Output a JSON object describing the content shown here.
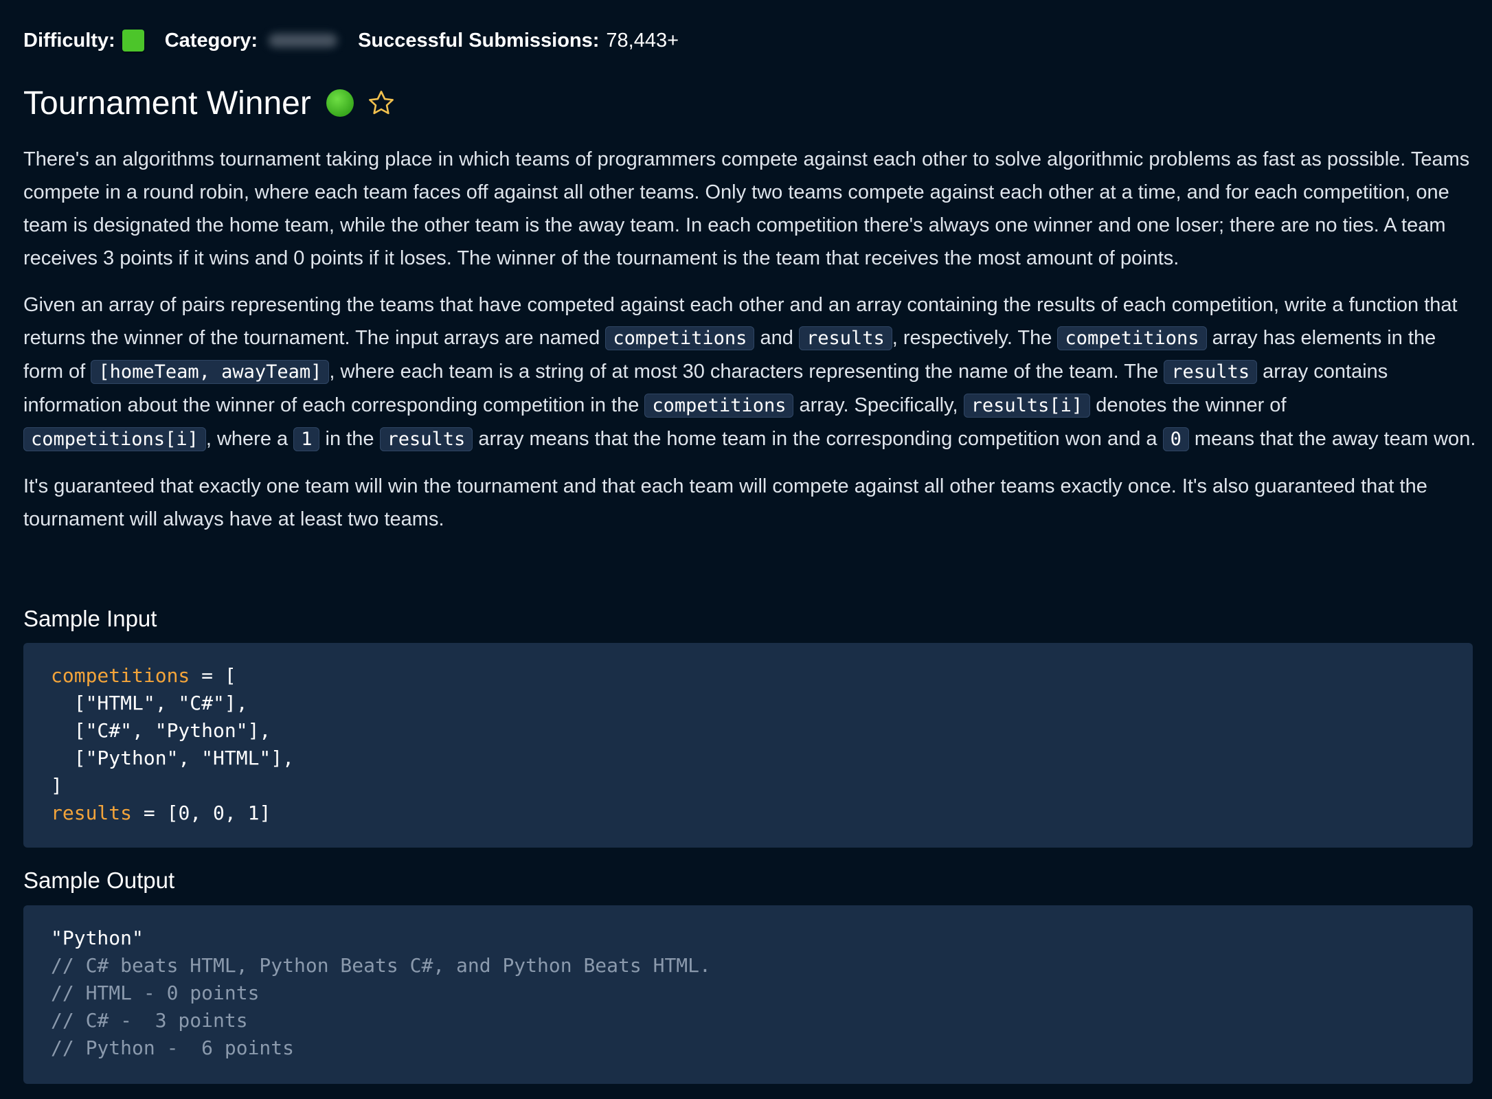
{
  "meta": {
    "difficulty_label": "Difficulty:",
    "category_label": "Category:",
    "submissions_label": "Successful Submissions:",
    "submissions_value": "78,443+",
    "difficulty_color": "#4cc52a"
  },
  "problem": {
    "title": "Tournament Winner",
    "status_color": "#4cc52a",
    "star_icon": "star-outline-icon"
  },
  "description": {
    "p1": "There's an algorithms tournament taking place in which teams of programmers compete against each other to solve algorithmic problems as fast as possible. Teams compete in a round robin, where each team faces off against all other teams. Only two teams compete against each other at a time, and for each competition, one team is designated the home team, while the other team is the away team. In each competition there's always one winner and one loser; there are no ties. A team receives 3 points if it wins and 0 points if it loses. The winner of the tournament is the team that receives the most amount of points.",
    "p2": {
      "t1": "Given an array of pairs representing the teams that have competed against each other and an array containing the results of each competition, write a function that returns the winner of the tournament. The input arrays are named ",
      "c1": "competitions",
      "t2": " and ",
      "c2": "results",
      "t3": ", respectively. The ",
      "c3": "competitions",
      "t4": " array has elements in the form of ",
      "c4": "[homeTeam, awayTeam]",
      "t5": ", where each team is a string of at most 30 characters representing the name of the team. The ",
      "c5": "results",
      "t6": " array contains information about the winner of each corresponding competition in the ",
      "c6": "competitions",
      "t7": " array. Specifically, ",
      "c7": "results[i]",
      "t8": " denotes the winner of ",
      "c8": "competitions[i]",
      "t9": ", where a ",
      "c9": "1",
      "t10": " in the ",
      "c10": "results",
      "t11": " array means that the home team in the corresponding competition won and a ",
      "c11": "0",
      "t12": " means that the away team won."
    },
    "p3": "It's guaranteed that exactly one team will win the tournament and that each team will compete against all other teams exactly once. It's also guaranteed that the tournament will always have at least two teams."
  },
  "sample_input": {
    "title": "Sample Input",
    "l1_var": "competitions",
    "l1_rest": " = [",
    "l2": "  [\"HTML\", \"C#\"],",
    "l3": "  [\"C#\", \"Python\"],",
    "l4": "  [\"Python\", \"HTML\"],",
    "l5": "]",
    "l6_var": "results",
    "l6_rest": " = [0, 0, 1]"
  },
  "sample_output": {
    "title": "Sample Output",
    "l1": "\"Python\"",
    "l2": "// C# beats HTML, Python Beats C#, and Python Beats HTML.",
    "l3": "// HTML - 0 points",
    "l4": "// C# -  3 points",
    "l5": "// Python -  6 points"
  }
}
